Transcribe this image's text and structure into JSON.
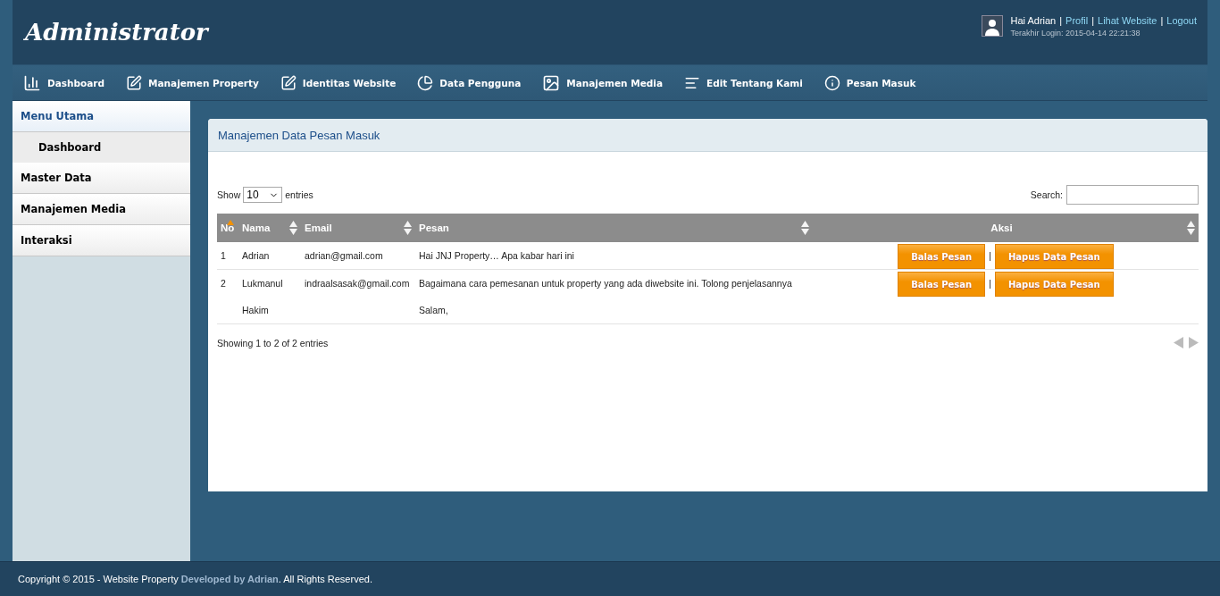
{
  "header": {
    "title": "Administrator",
    "items": [
      {
        "text": "Hai Adrian",
        "kind": "text"
      },
      {
        "text": "|",
        "kind": "sep"
      },
      {
        "text": "Profil",
        "kind": "link"
      },
      {
        "text": "|",
        "kind": "sep"
      },
      {
        "text": "Lihat Website",
        "kind": "link"
      },
      {
        "text": "|",
        "kind": "sep"
      },
      {
        "text": "Logout",
        "kind": "link"
      }
    ],
    "last_login": "Terakhir Login: 2015-04-14 22:21:38"
  },
  "nav": [
    {
      "label": "Dashboard",
      "kind": "chart"
    },
    {
      "label": "Manajemen Property",
      "kind": "edit"
    },
    {
      "label": "Identitas Website",
      "kind": "edit"
    },
    {
      "label": "Data Pengguna",
      "kind": "pie"
    },
    {
      "label": "Manajemen Media",
      "kind": "image"
    },
    {
      "label": "Edit Tentang Kami",
      "kind": "lines"
    },
    {
      "label": "Pesan Masuk",
      "kind": "info"
    }
  ],
  "sidebar": {
    "items": [
      {
        "label": "Menu Utama",
        "expanded": true,
        "children": [
          {
            "label": "Dashboard"
          }
        ]
      },
      {
        "label": "Master Data",
        "expanded": false
      },
      {
        "label": "Manajemen Media",
        "expanded": false
      },
      {
        "label": "Interaksi",
        "expanded": false
      }
    ]
  },
  "panel": {
    "title": "Manajemen Data Pesan Masuk",
    "length": {
      "before": "Show",
      "value": "10",
      "after": "entries"
    },
    "search": {
      "label": "Search:"
    },
    "table": {
      "columns": [
        {
          "label": "No",
          "sorted": true
        },
        {
          "label": "Nama",
          "sorted": false
        },
        {
          "label": "Email",
          "sorted": false
        },
        {
          "label": "Pesan",
          "sorted": false
        },
        {
          "label": "Aksi",
          "sorted": false
        }
      ],
      "rows": [
        {
          "no": "1",
          "nama": "Adrian",
          "email": "adrian@gmail.com",
          "pesan": [
            "Hai JNJ Property… Apa kabar hari ini"
          ],
          "actions": [
            "Balas Pesan",
            "|",
            "Hapus Data Pesan"
          ]
        },
        {
          "no": "2",
          "nama": "Lukmanul Hakim",
          "email": "indraalsasak@gmail.com",
          "pesan": [
            "Bagaimana cara pemesanan untuk property yang ada diwebsite ini. Tolong penjelasannya",
            "Salam,"
          ],
          "actions": [
            "Balas Pesan",
            "|",
            "Hapus Data Pesan"
          ]
        }
      ]
    },
    "info": "Showing 1 to 2 of 2 entries"
  },
  "footer": "Copyright © 2015 - Website Property **Developed by Adrian**. All Rights Reserved."
}
